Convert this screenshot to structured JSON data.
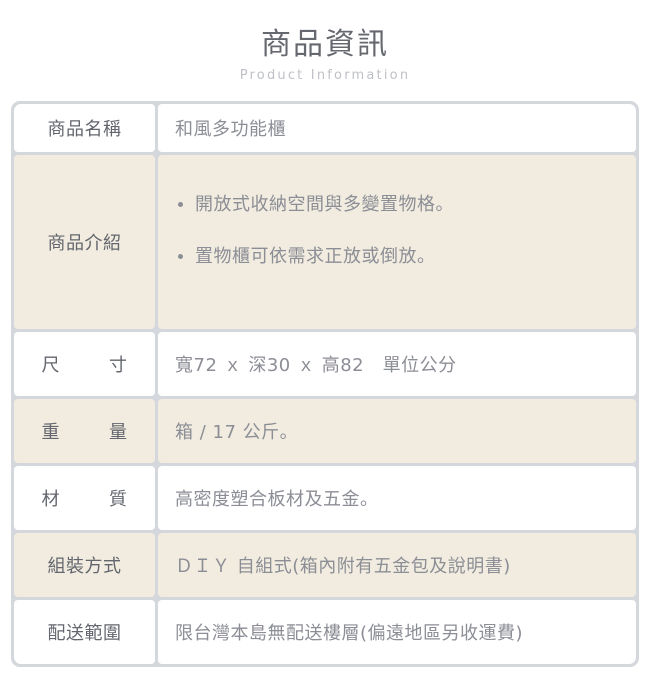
{
  "header": {
    "title": "商品資訊",
    "subtitle": "Product Information"
  },
  "colors": {
    "table_gap": "#d4d8dd",
    "row_tint": "#f1ecdf",
    "row_plain": "#ffffff",
    "label_text": "#63666e",
    "value_text": "#8c8e96",
    "title_text": "#65686f",
    "subtitle_text": "#bfc1c6"
  },
  "table": {
    "rows": [
      {
        "label": "商品名稱",
        "value": "和風多功能櫃"
      },
      {
        "label": "商品介紹",
        "bullets": [
          "開放式收納空間與多變置物格。",
          "置物櫃可依需求正放或倒放。"
        ]
      },
      {
        "label": "尺　寸",
        "value": "寬72 ｘ 深30 ｘ 高82　單位公分"
      },
      {
        "label": "重　量",
        "value": "箱 / 17 公斤。"
      },
      {
        "label": "材　質",
        "value": "高密度塑合板材及五金。"
      },
      {
        "label": "組裝方式",
        "value": "ＤＩＹ 自組式(箱內附有五金包及說明書)"
      },
      {
        "label": "配送範圍",
        "value": "限台灣本島無配送樓層(偏遠地區另收運費)"
      }
    ]
  }
}
